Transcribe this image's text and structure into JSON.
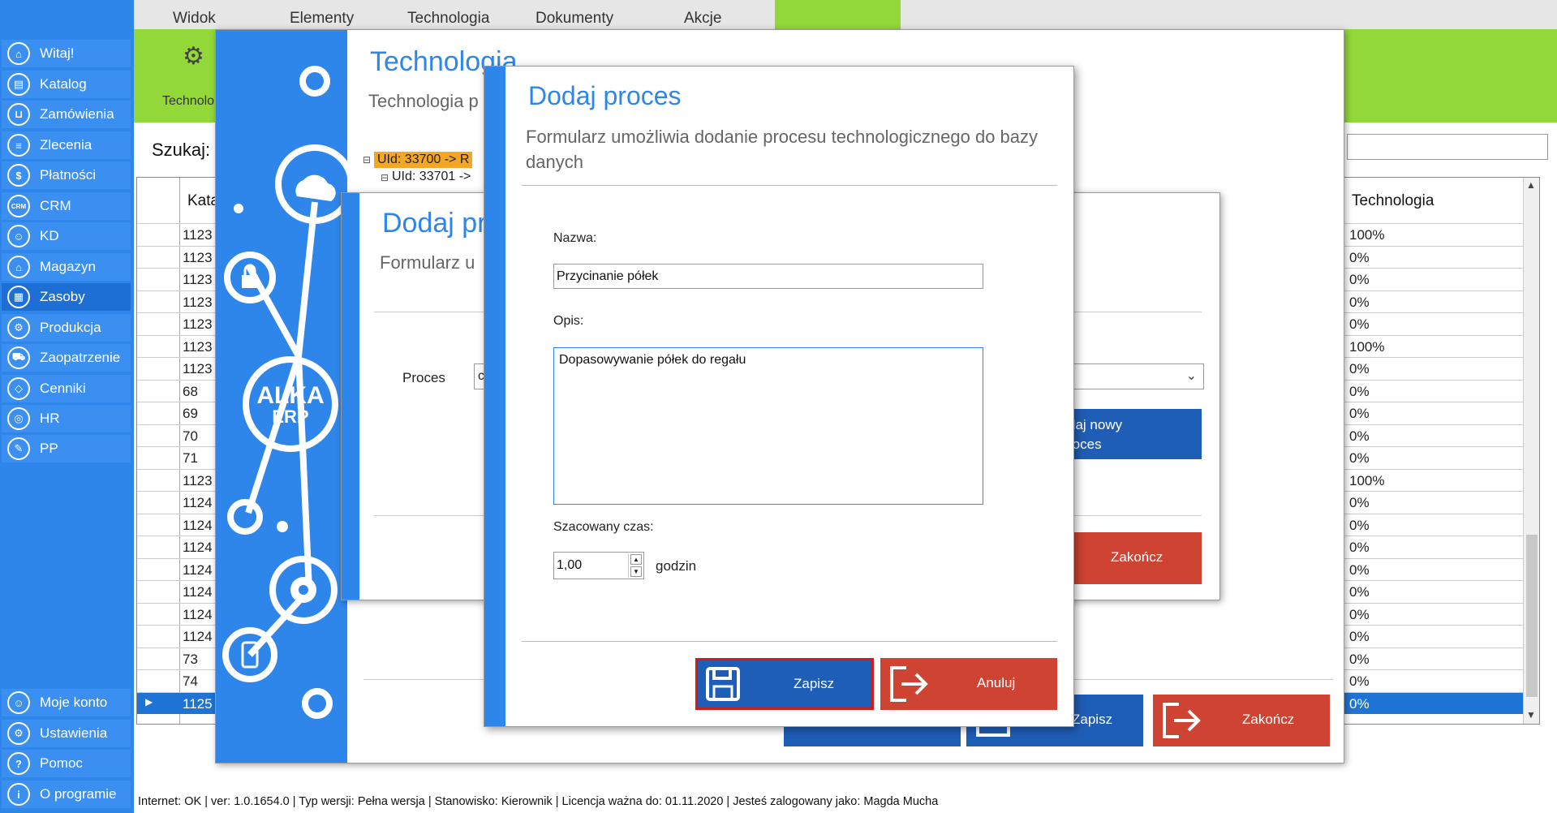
{
  "sidebar": {
    "items": [
      {
        "label": "Witaj!",
        "icon": "home-icon",
        "glyph": "⌂"
      },
      {
        "label": "Katalog",
        "icon": "book-icon",
        "glyph": "▤"
      },
      {
        "label": "Zamówienia",
        "icon": "cart-icon",
        "glyph": "⊔"
      },
      {
        "label": "Zlecenia",
        "icon": "list-icon",
        "glyph": "≡"
      },
      {
        "label": "Płatności",
        "icon": "dollar-icon",
        "glyph": "$"
      },
      {
        "label": "CRM",
        "icon": "crm-icon",
        "glyph": "CRM"
      },
      {
        "label": "KD",
        "icon": "user-icon",
        "glyph": "☺"
      },
      {
        "label": "Magazyn",
        "icon": "warehouse-icon",
        "glyph": "⌂"
      },
      {
        "label": "Zasoby",
        "icon": "resources-icon",
        "glyph": "▦"
      },
      {
        "label": "Produkcja",
        "icon": "production-icon",
        "glyph": "⚙"
      },
      {
        "label": "Zaopatrzenie",
        "icon": "truck-icon",
        "glyph": "⛟"
      },
      {
        "label": "Cenniki",
        "icon": "tag-icon",
        "glyph": "◇"
      },
      {
        "label": "HR",
        "icon": "hr-icon",
        "glyph": "◎"
      },
      {
        "label": "PP",
        "icon": "pp-icon",
        "glyph": "✎"
      }
    ],
    "bottom": [
      {
        "label": "Moje konto",
        "icon": "account-icon",
        "glyph": "☺"
      },
      {
        "label": "Ustawienia",
        "icon": "settings-icon",
        "glyph": "⚙"
      },
      {
        "label": "Pomoc",
        "icon": "help-icon",
        "glyph": "?"
      },
      {
        "label": "O programie",
        "icon": "info-icon",
        "glyph": "i"
      }
    ]
  },
  "topmenu": [
    "Widok",
    "Elementy",
    "Technologia",
    "Dokumenty",
    "Akcje"
  ],
  "ribbon": {
    "label": "Technolo",
    "icon": "gears-icon"
  },
  "search": {
    "label": "Szukaj:"
  },
  "grid": {
    "header_left": "Kata",
    "header_right": "Technologia",
    "rows": [
      {
        "c1": "1123",
        "c2": "100%"
      },
      {
        "c1": "1123",
        "c2": "0%"
      },
      {
        "c1": "1123",
        "c2": "0%"
      },
      {
        "c1": "1123",
        "c2": "0%"
      },
      {
        "c1": "1123",
        "c2": "0%"
      },
      {
        "c1": "1123",
        "c2": "100%"
      },
      {
        "c1": "1123",
        "c2": "0%"
      },
      {
        "c1": "68",
        "c2": "0%"
      },
      {
        "c1": "69",
        "c2": "0%"
      },
      {
        "c1": "70",
        "c2": "0%"
      },
      {
        "c1": "71",
        "c2": "0%"
      },
      {
        "c1": "1123",
        "c2": "100%"
      },
      {
        "c1": "1124",
        "c2": "0%"
      },
      {
        "c1": "1124",
        "c2": "0%"
      },
      {
        "c1": "1124",
        "c2": "0%"
      },
      {
        "c1": "1124",
        "c2": "0%"
      },
      {
        "c1": "1124",
        "c2": "0%"
      },
      {
        "c1": "1124",
        "c2": "0%"
      },
      {
        "c1": "1124",
        "c2": "0%"
      },
      {
        "c1": "73",
        "c2": "0%"
      },
      {
        "c1": "74",
        "c2": "0%"
      },
      {
        "c1": "1125",
        "c2": "0%",
        "selected": true
      }
    ]
  },
  "statusbar": "Internet: OK  |  ver: 1.0.1654.0  |  Typ wersji: Pełna wersja  |  Stanowisko: Kierownik  |  Licencja ważna do: 01.11.2020  |  Jesteś zalogowany jako: Magda Mucha",
  "dlg1": {
    "title": "Technologia",
    "subtitle": "Technologia p",
    "tree_node1": "UId: 33700 -> R",
    "tree_node2": "UId: 33701 ->",
    "logo_line1": "ALKA",
    "logo_line2": "ERP",
    "btn_zapisz": "Zapisz",
    "btn_zakoncz": "Zakończ"
  },
  "dlg2": {
    "title": "Dodaj pr",
    "subtitle": "Formularz u",
    "proces_label": "Proces",
    "combo_value": "c",
    "btn_nowy_l1": "daj nowy",
    "btn_nowy_l2": "roces",
    "btn_zakoncz": "Zakończ"
  },
  "dlg3": {
    "title": "Dodaj proces",
    "subtitle": "Formularz umożliwia dodanie procesu technologicznego do bazy danych",
    "nazwa_label": "Nazwa:",
    "nazwa_value": "Przycinanie półek",
    "opis_label": "Opis:",
    "opis_value": "Dopasowywanie półek do regału",
    "czas_label": "Szacowany czas:",
    "czas_value": "1,00",
    "czas_unit": "godzin",
    "btn_zapisz": "Zapisz",
    "btn_anuluj": "Anuluj"
  },
  "colors": {
    "accent": "#2f86ea",
    "ribbon": "#93d839",
    "danger": "#cf4332",
    "button_blue": "#1f5eb7"
  }
}
